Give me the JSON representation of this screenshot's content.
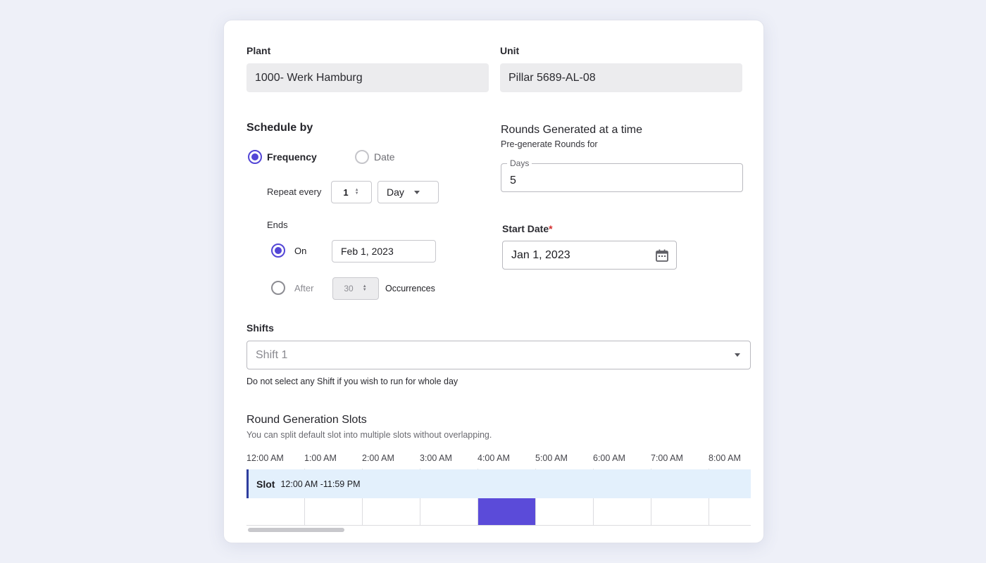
{
  "plant": {
    "label": "Plant",
    "value": "1000- Werk Hamburg"
  },
  "unit": {
    "label": "Unit",
    "value": "Pillar 5689-AL-08"
  },
  "schedule": {
    "title": "Schedule by",
    "options": [
      "Frequency",
      "Date"
    ],
    "selected": "Frequency",
    "repeat_label": "Repeat every",
    "repeat_value": "1",
    "repeat_unit": "Day",
    "ends_label": "Ends",
    "on_label": "On",
    "on_date": "Feb 1, 2023",
    "after_label": "After",
    "after_value": "30",
    "occurrences_label": "Occurrences"
  },
  "rounds": {
    "title": "Rounds Generated at a time",
    "subtitle": "Pre-generate Rounds for",
    "days_label": "Days",
    "days_value": "5"
  },
  "start_date": {
    "label": "Start Date",
    "required_mark": "*",
    "value": "Jan 1, 2023"
  },
  "shifts": {
    "label": "Shifts",
    "placeholder": "Shift 1",
    "helper": "Do not select any Shift if you wish to run for whole day"
  },
  "slots": {
    "title": "Round Generation Slots",
    "subtitle": "You can split default slot into multiple slots without overlapping.",
    "hours": [
      "12:00 AM",
      "1:00 AM",
      "2:00 AM",
      "3:00 AM",
      "4:00 AM",
      "5:00 AM",
      "6:00 AM",
      "7:00 AM",
      "8:00 AM"
    ],
    "slot_label": "Slot",
    "slot_range": "12:00 AM -11:59 PM",
    "highlighted_hour": "4:00 AM"
  },
  "colors": {
    "accent": "#5346d6",
    "slot_bg": "#e3f0fc",
    "highlight": "#5b4bd9",
    "required": "#d32f2f"
  }
}
